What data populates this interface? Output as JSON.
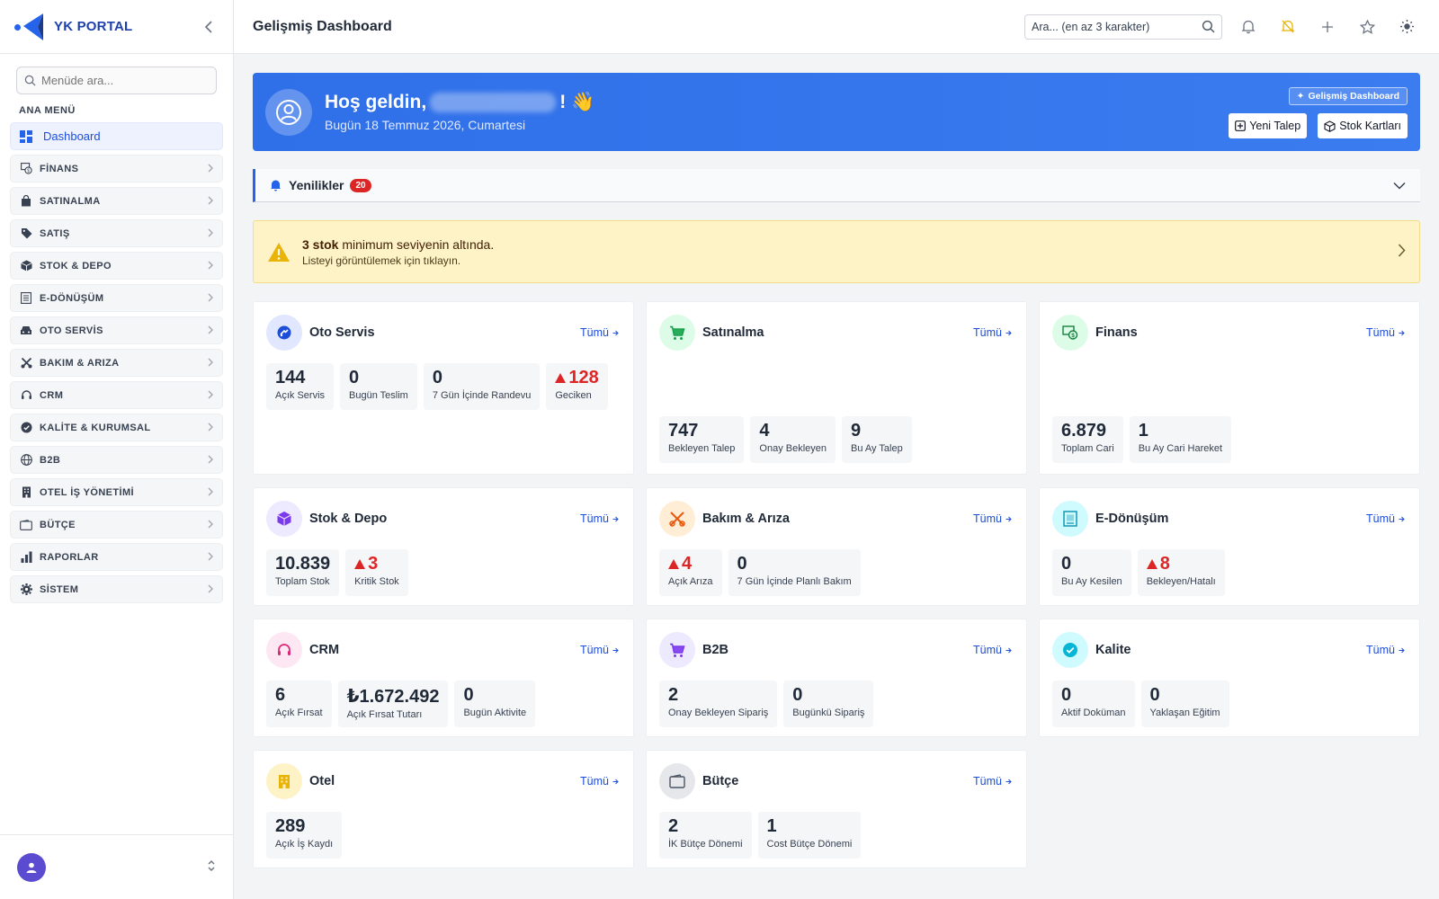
{
  "brand": {
    "name": "YK PORTAL"
  },
  "sidebar": {
    "search_placeholder": "Menüde ara...",
    "section_title": "ANA MENÜ",
    "items": [
      {
        "label": "Dashboard",
        "icon": "dashboard-icon"
      },
      {
        "label": "FİNANS",
        "icon": "finance-icon"
      },
      {
        "label": "SATINALMA",
        "icon": "shopping-bag-icon"
      },
      {
        "label": "SATIŞ",
        "icon": "tag-icon"
      },
      {
        "label": "STOK & DEPO",
        "icon": "box-icon"
      },
      {
        "label": "E-DÖNÜŞÜM",
        "icon": "document-icon"
      },
      {
        "label": "OTO SERVİS",
        "icon": "car-icon"
      },
      {
        "label": "BAKIM & ARIZA",
        "icon": "tools-icon"
      },
      {
        "label": "CRM",
        "icon": "headset-icon"
      },
      {
        "label": "KALİTE & KURUMSAL",
        "icon": "badge-check-icon"
      },
      {
        "label": "B2B",
        "icon": "globe-icon"
      },
      {
        "label": "OTEL İŞ YÖNETİMİ",
        "icon": "building-icon"
      },
      {
        "label": "BÜTÇE",
        "icon": "wallet-icon"
      },
      {
        "label": "RAPORLAR",
        "icon": "bar-chart-icon"
      },
      {
        "label": "SİSTEM",
        "icon": "gear-icon"
      }
    ]
  },
  "header": {
    "title": "Gelişmiş Dashboard",
    "search_placeholder": "Ara... (en az 3 karakter)"
  },
  "welcome": {
    "greeting": "Hoş geldin,",
    "exclaim": "!",
    "emoji": "👋",
    "date": "Bugün 18 Temmuz 2026, Cumartesi",
    "badge": "Gelişmiş Dashboard",
    "btn_new_request": "Yeni Talep",
    "btn_stock_cards": "Stok Kartları"
  },
  "news": {
    "title": "Yenilikler",
    "count": "20"
  },
  "alert": {
    "bold": "3 stok",
    "text": " minimum seviyenin altında.",
    "sub": "Listeyi görüntülemek için tıklayın."
  },
  "link_label": "Tümü",
  "cards": [
    {
      "title": "Oto Servis",
      "icon": "car-service-icon",
      "bg": "#e0e7ff",
      "fg": "#1d4ed8",
      "stats": [
        {
          "value": "144",
          "label": "Açık Servis"
        },
        {
          "value": "0",
          "label": "Bugün Teslim"
        },
        {
          "value": "0",
          "label": "7 Gün İçinde Randevu"
        },
        {
          "value": "128",
          "label": "Geciken",
          "danger": true
        }
      ]
    },
    {
      "title": "Satınalma",
      "icon": "cart-icon",
      "bg": "#dcfce7",
      "fg": "#16a34a",
      "stats": [
        {
          "value": "747",
          "label": "Bekleyen Talep"
        },
        {
          "value": "4",
          "label": "Onay Bekleyen"
        },
        {
          "value": "9",
          "label": "Bu Ay Talep"
        }
      ]
    },
    {
      "title": "Finans",
      "icon": "money-icon",
      "bg": "#dcfce7",
      "fg": "#15803d",
      "stats": [
        {
          "value": "6.879",
          "label": "Toplam Cari"
        },
        {
          "value": "1",
          "label": "Bu Ay Cari Hareket"
        }
      ]
    },
    {
      "title": "Stok & Depo",
      "icon": "cube-icon",
      "bg": "#ede9fe",
      "fg": "#7c3aed",
      "stats": [
        {
          "value": "10.839",
          "label": "Toplam Stok"
        },
        {
          "value": "3",
          "label": "Kritik Stok",
          "danger": true
        }
      ]
    },
    {
      "title": "Bakım & Arıza",
      "icon": "tools-icon",
      "bg": "#ffedd5",
      "fg": "#ea580c",
      "stats": [
        {
          "value": "4",
          "label": "Açık Arıza",
          "danger": true
        },
        {
          "value": "0",
          "label": "7 Gün İçinde Planlı Bakım"
        }
      ]
    },
    {
      "title": "E-Dönüşüm",
      "icon": "invoice-icon",
      "bg": "#cffafe",
      "fg": "#0891b2",
      "stats": [
        {
          "value": "0",
          "label": "Bu Ay Kesilen"
        },
        {
          "value": "8",
          "label": "Bekleyen/Hatalı",
          "danger": true
        }
      ]
    },
    {
      "title": "CRM",
      "icon": "headset-icon",
      "bg": "#fce7f3",
      "fg": "#db2777",
      "stats": [
        {
          "value": "6",
          "label": "Açık Fırsat"
        },
        {
          "value": "₺1.672.492",
          "label": "Açık Fırsat Tutarı"
        },
        {
          "value": "0",
          "label": "Bugün Aktivite"
        }
      ]
    },
    {
      "title": "B2B",
      "icon": "cart-icon",
      "bg": "#ede9fe",
      "fg": "#7c3aed",
      "stats": [
        {
          "value": "2",
          "label": "Onay Bekleyen Sipariş"
        },
        {
          "value": "0",
          "label": "Bugünkü Sipariş"
        }
      ]
    },
    {
      "title": "Kalite",
      "icon": "badge-check-icon",
      "bg": "#cffafe",
      "fg": "#06b6d4",
      "stats": [
        {
          "value": "0",
          "label": "Aktif Doküman"
        },
        {
          "value": "0",
          "label": "Yaklaşan Eğitim"
        }
      ]
    },
    {
      "title": "Otel",
      "icon": "building-icon",
      "bg": "#fef3c7",
      "fg": "#eab308",
      "stats": [
        {
          "value": "289",
          "label": "Açık İş Kaydı"
        }
      ]
    },
    {
      "title": "Bütçe",
      "icon": "wallet-icon",
      "bg": "#e5e7eb",
      "fg": "#4b5563",
      "stats": [
        {
          "value": "2",
          "label": "İK Bütçe Dönemi"
        },
        {
          "value": "1",
          "label": "Cost Bütçe Dönemi"
        }
      ]
    }
  ]
}
